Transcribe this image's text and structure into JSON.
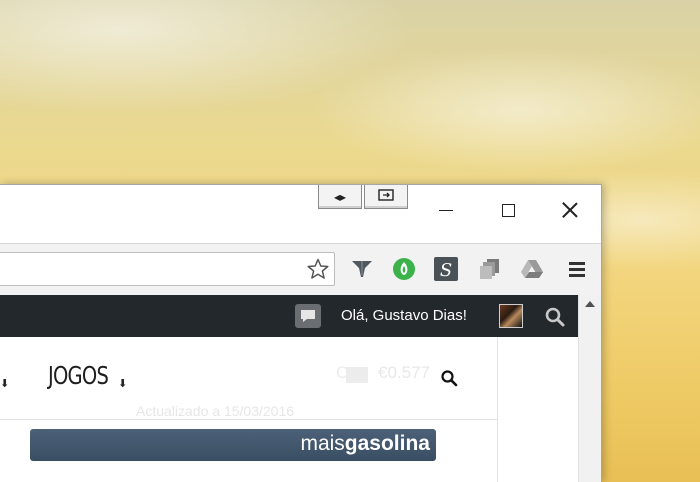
{
  "titlebar": {
    "snap_left_glyph": "◂▸",
    "snap_right_glyph": "⇥"
  },
  "toolbar": {
    "extensions": [
      "bookmark-star-icon",
      "funnel-extension-icon",
      "green-leaf-extension-icon",
      "s-extension-icon",
      "stack-extension-icon",
      "drive-extension-icon",
      "menu-icon"
    ]
  },
  "adminbar": {
    "greeting": "Olá, Gustavo Dias!"
  },
  "content": {
    "nav_item": "JOGOS",
    "nav_arrow": "⬇",
    "left_arrow": "⬇",
    "ghost_c": "C",
    "price": "€0.577",
    "updated": "Actualizado a 15/03/2016",
    "banner_regular": "mais",
    "banner_bold": "gasolina"
  },
  "colors": {
    "adminbar_bg": "#23282d",
    "banner_bg": "#3f5369",
    "leaf_green": "#3cb34a"
  }
}
